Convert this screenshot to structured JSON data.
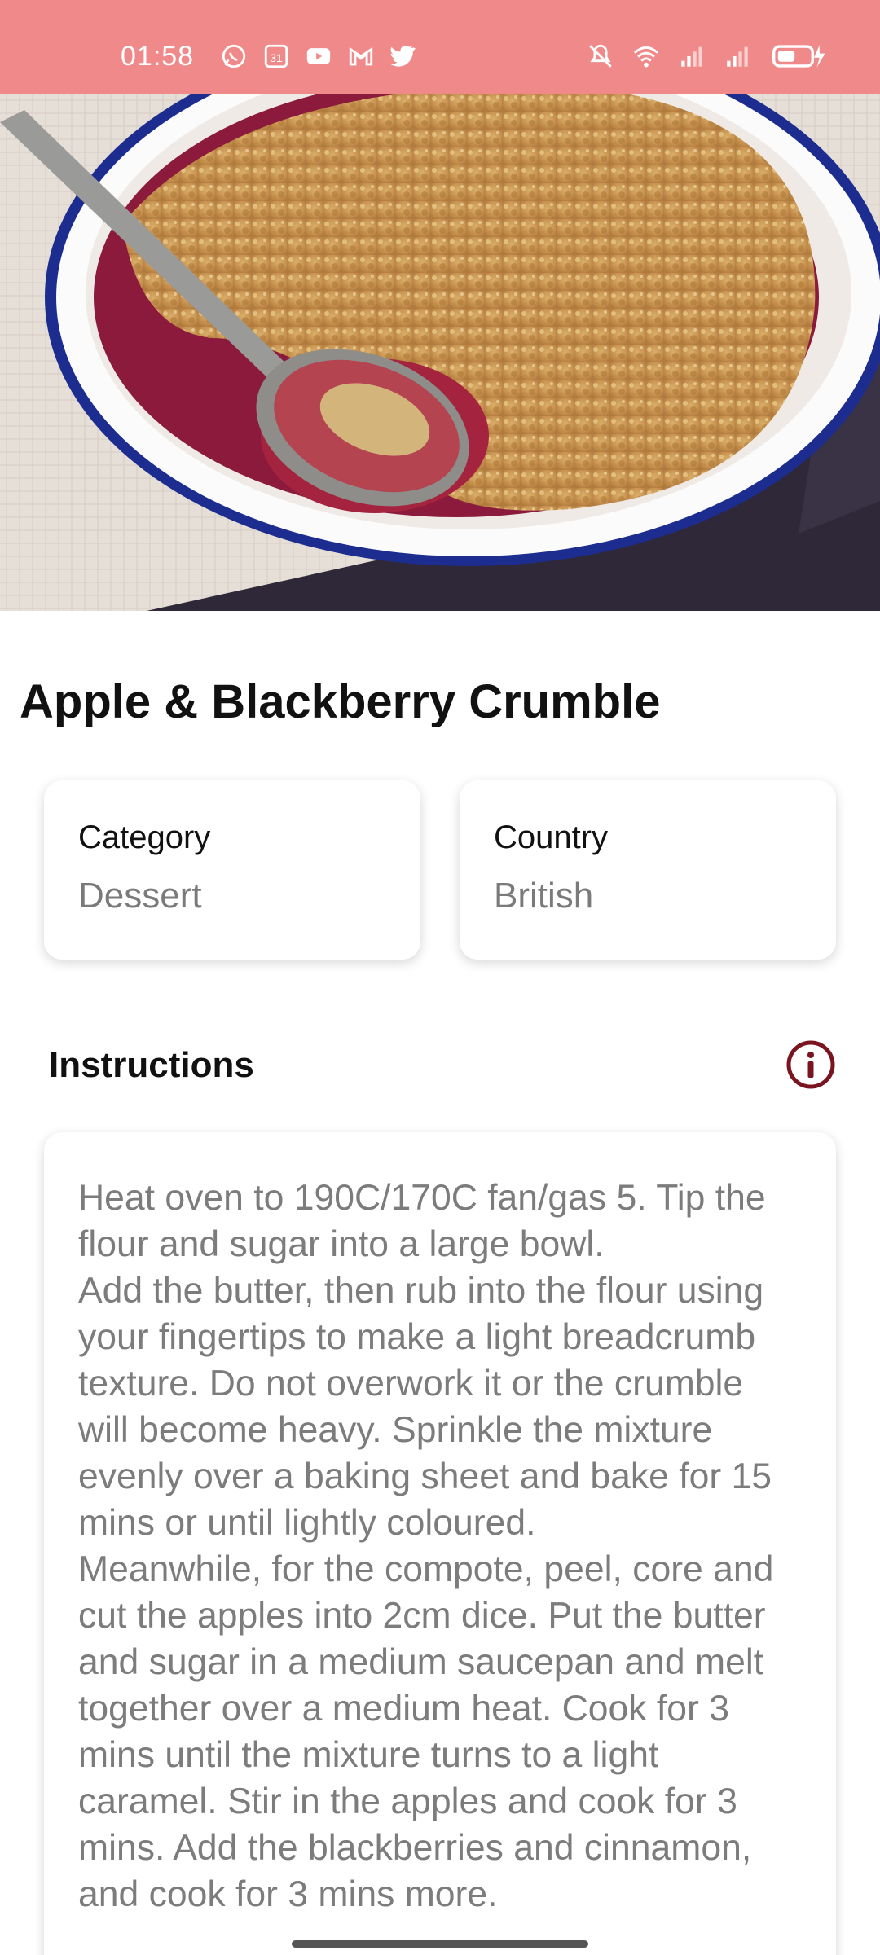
{
  "status_bar": {
    "time": "01:58",
    "left_icons": [
      "whatsapp-icon",
      "calendar-icon",
      "youtube-icon",
      "gmail-icon",
      "twitter-icon"
    ],
    "calendar_day": "31",
    "right_icons": [
      "mute-icon",
      "wifi-icon",
      "signal-icon",
      "signal-icon",
      "battery-icon"
    ],
    "bg_color": "#f08a8a"
  },
  "meal": {
    "title": "Apple & Blackberry Crumble",
    "image_subject": "crumble-dish-photo"
  },
  "cards": {
    "category_label": "Category",
    "category_value": "Dessert",
    "country_label": "Country",
    "country_value": "British"
  },
  "instructions": {
    "heading": "Instructions",
    "icon": "info-icon",
    "icon_color": "#7a1420",
    "text": "Heat oven to 190C/170C fan/gas 5. Tip the flour and sugar into a large bowl.\nAdd the butter, then rub into the flour using your fingertips to make a light breadcrumb texture. Do not overwork it or the crumble will become heavy. Sprinkle the mixture evenly over a baking sheet and bake for 15 mins or until lightly coloured.\nMeanwhile, for the compote, peel, core and cut the apples into 2cm dice. Put the butter and sugar in a medium saucepan and melt together over a medium heat. Cook for 3 mins until the mixture turns to a light caramel. Stir in the apples and cook for 3 mins. Add the blackberries and cinnamon, and cook for 3 mins more."
  }
}
